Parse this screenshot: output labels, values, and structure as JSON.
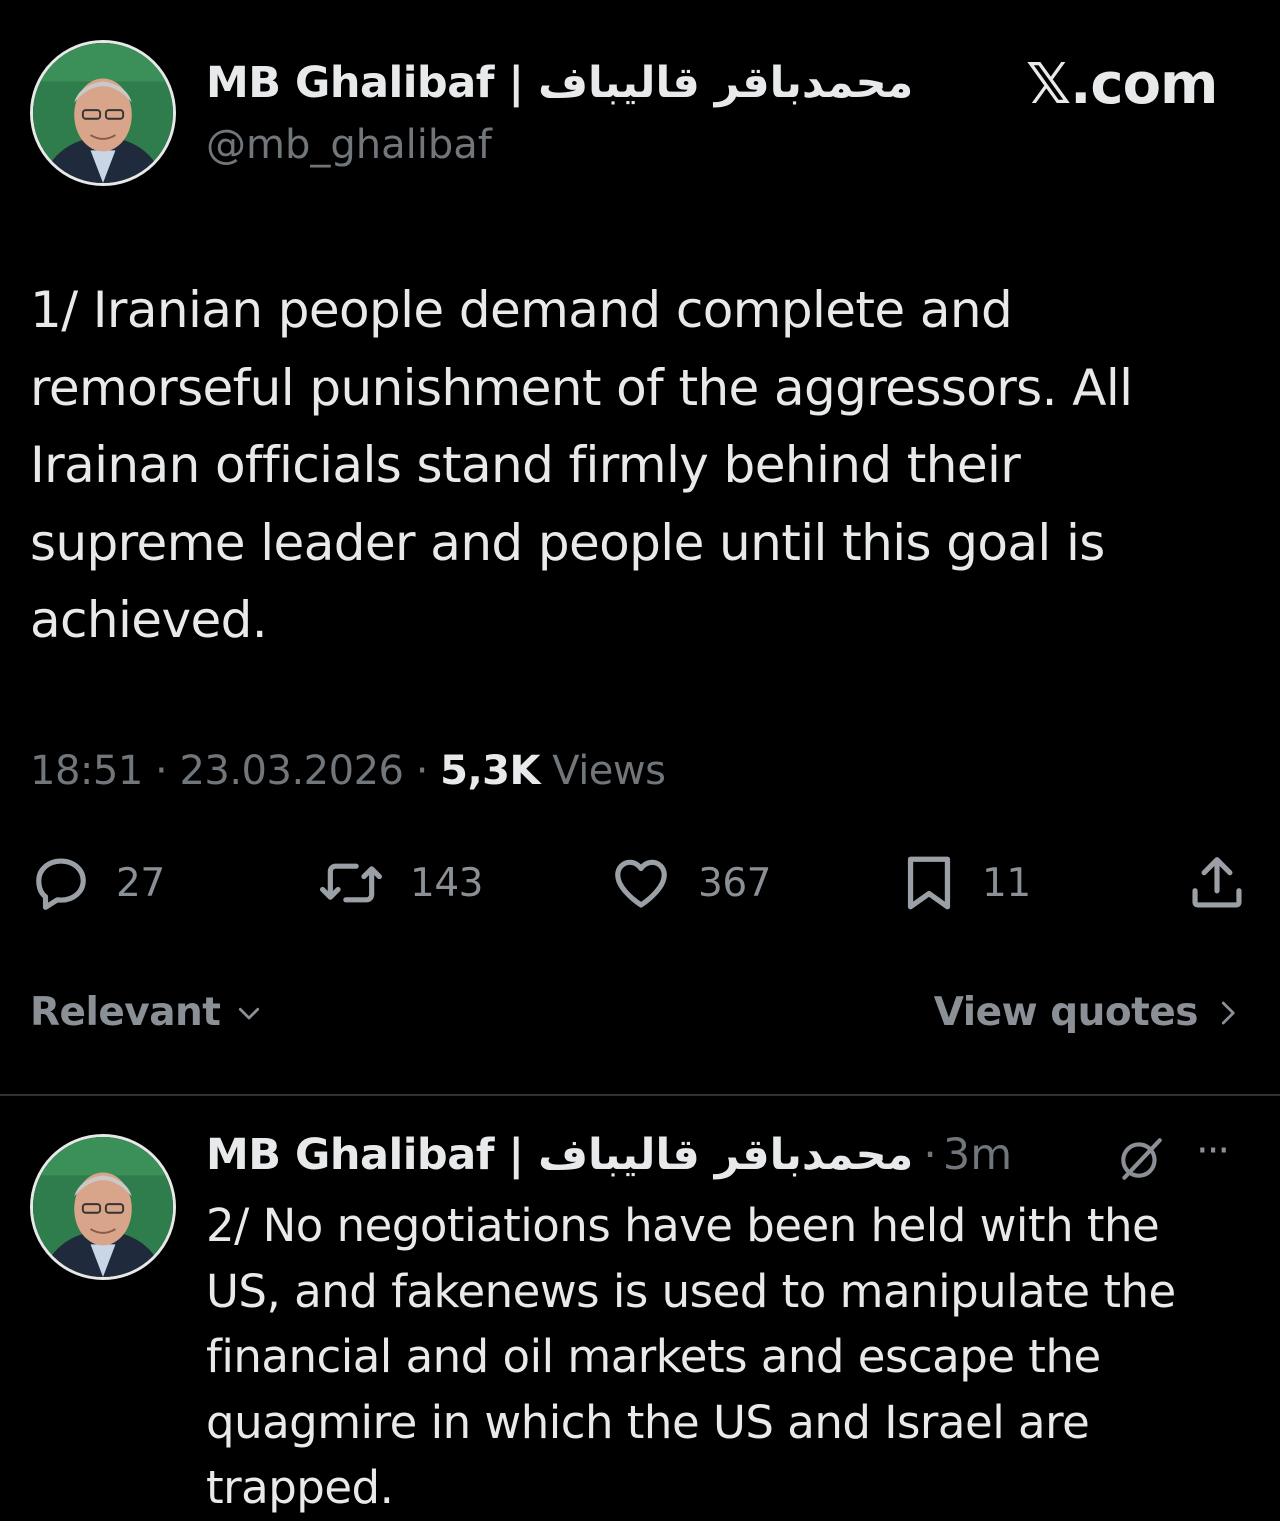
{
  "site": {
    "mark": "𝕏.com"
  },
  "main_tweet": {
    "author": {
      "display_name": "MB Ghalibaf | محمدباقر قالیباف",
      "handle": "@mb_ghalibaf"
    },
    "text": "1/ Iranian people demand complete and remorseful punishment of the aggressors. All Irainan officials stand firmly behind their supreme leader and people until this goal is achieved.",
    "time": "18:51",
    "date": "23.03.2026",
    "views_count": "5,3K",
    "views_label": "Views",
    "separator": "·",
    "actions": {
      "replies": "27",
      "reposts": "143",
      "likes": "367",
      "bookmarks": "11"
    },
    "icons": {
      "reply": "reply-icon",
      "repost": "repost-icon",
      "like": "heart-icon",
      "bookmark": "bookmark-icon",
      "share": "share-icon"
    }
  },
  "replies_bar": {
    "sort_label": "Relevant",
    "view_quotes_label": "View quotes"
  },
  "reply": {
    "author": {
      "display_name": "MB Ghalibaf | محمدباقر قالیباف"
    },
    "separator": "·",
    "age": "3m",
    "text": "2/ No negotiations have been held with the US, and fakenews is used to manipulate the financial and oil markets and escape the quagmire in which the US and Israel are trapped.",
    "more_label": "···"
  },
  "colors": {
    "background": "#000000",
    "primary_text": "#e7e9ea",
    "secondary_text": "#71767b",
    "divider": "#2f3336"
  }
}
